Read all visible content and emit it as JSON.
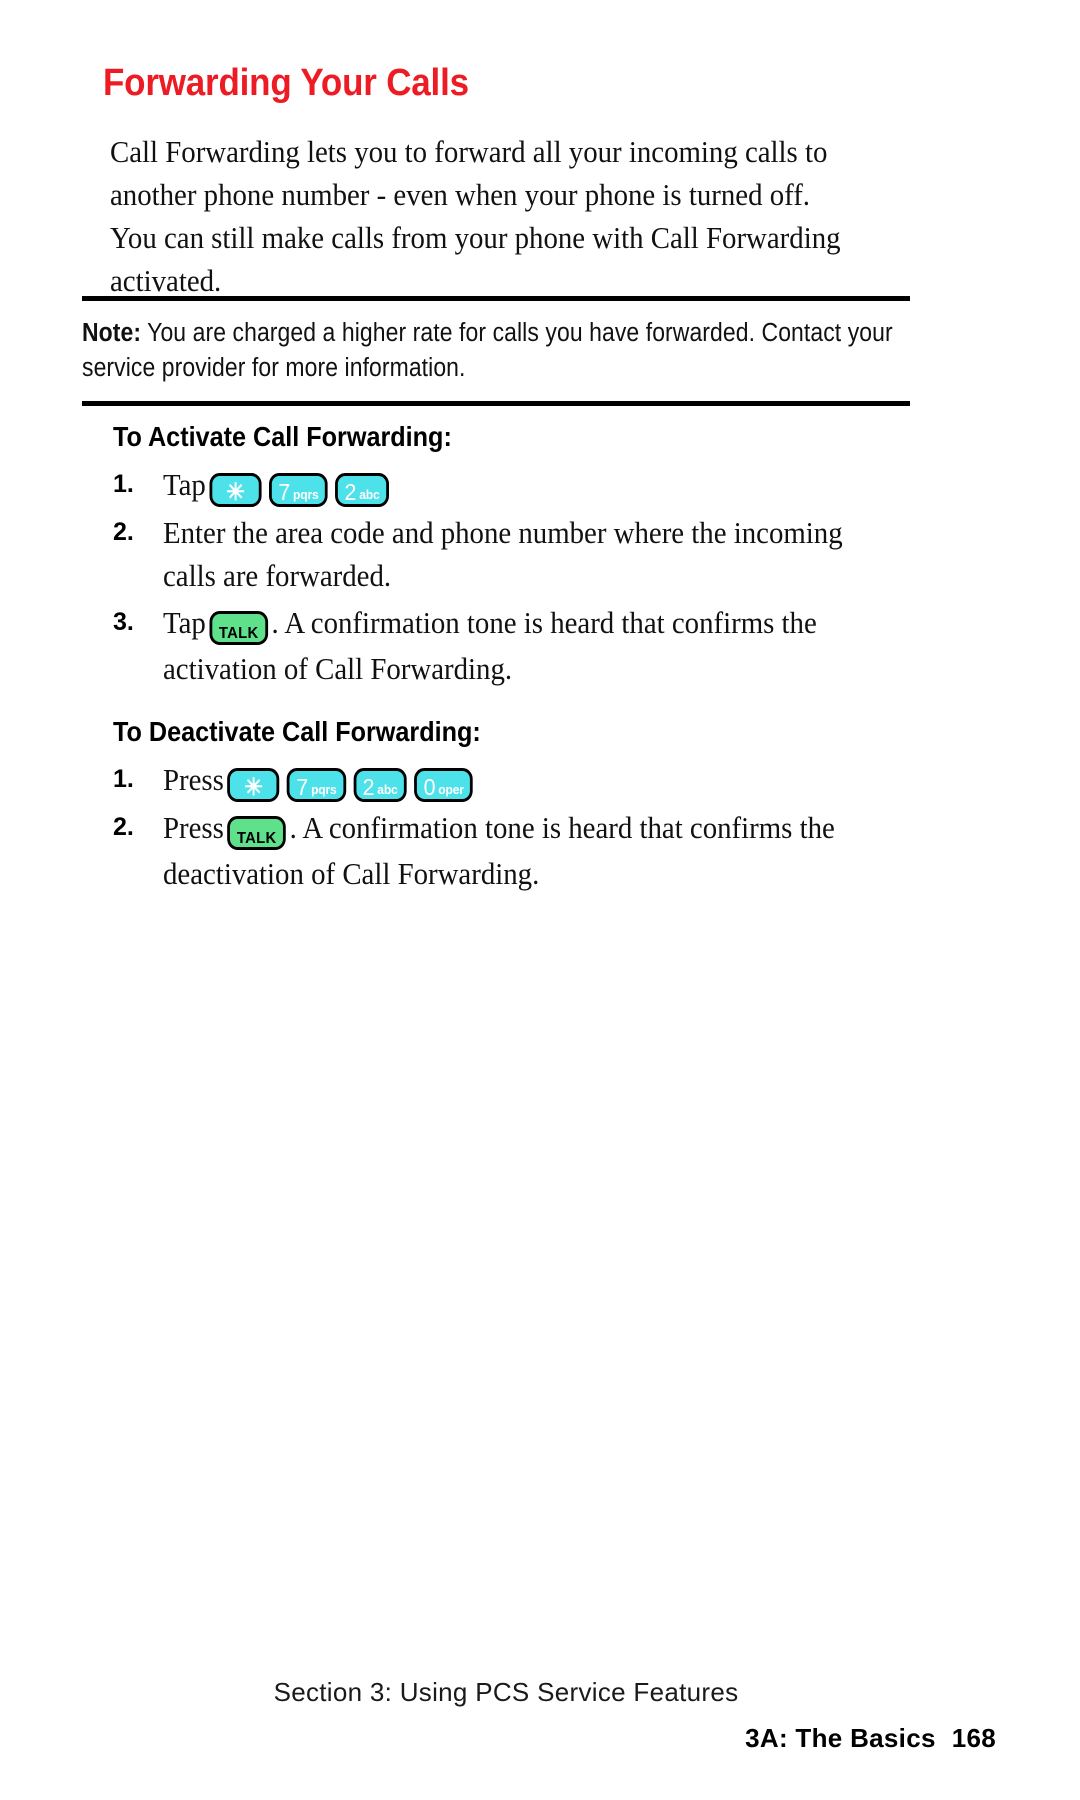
{
  "page": {
    "title": "Forwarding Your Calls",
    "title_color": "#ED1C24",
    "intro": "Call Forwarding lets you to forward all your incoming calls to another phone number - even when your phone is turned off. You can still make calls from your phone with Call Forwarding activated."
  },
  "note": {
    "label": "Note:",
    "text": " You are charged a higher rate for calls you have forwarded. Contact your service provider for more information."
  },
  "sections": {
    "activate": {
      "heading": "To Activate Call Forwarding:",
      "steps": [
        {
          "number": "1.",
          "text_before": "Tap",
          "text_after": "",
          "keys": [
            "star",
            "7pqrs",
            "2abc"
          ]
        },
        {
          "number": "2.",
          "text_before": "Enter the area code and phone number where the incoming calls are forwarded.",
          "text_after": "",
          "keys": []
        },
        {
          "number": "3.",
          "text_before": "Tap",
          "text_after": ". A confirmation tone is heard that confirms the activation of Call Forwarding.",
          "keys": [
            "talk"
          ]
        }
      ]
    },
    "deactivate": {
      "heading": "To Deactivate Call Forwarding:",
      "steps": [
        {
          "number": "1.",
          "text_before": "Press",
          "text_after": "",
          "keys": [
            "star",
            "7pqrs",
            "2abc",
            "0oper"
          ]
        },
        {
          "number": "2.",
          "text_before": "Press",
          "text_after": ". A confirmation tone is heard that confirms the deactivation of Call Forwarding.",
          "keys": [
            "talk"
          ]
        }
      ]
    }
  },
  "keys": {
    "star": {
      "glyph": "✳",
      "letters": "",
      "color": "#4DE2EA",
      "name": "star-key"
    },
    "seven": {
      "glyph": "7",
      "letters": "pqrs",
      "color": "#4DE2EA",
      "name": "seven-pqrs-key"
    },
    "two": {
      "glyph": "2",
      "letters": "abc",
      "color": "#4DE2EA",
      "name": "two-abc-key"
    },
    "zero": {
      "glyph": "0",
      "letters": "oper",
      "color": "#4DE2EA",
      "name": "zero-oper-key"
    },
    "talk": {
      "glyph": "TALK",
      "letters": "",
      "color": "#5FE08A",
      "name": "talk-key"
    }
  },
  "footer": {
    "section_line": "Section 3: Using PCS Service Features",
    "chapter_line": "3A: The Basics",
    "page_number": "168"
  }
}
